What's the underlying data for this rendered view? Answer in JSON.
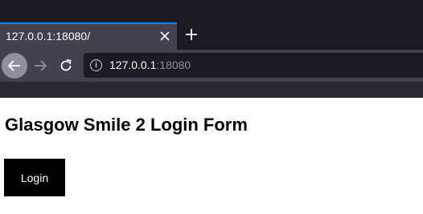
{
  "browser": {
    "tab_title": "127.0.0.1:18080/",
    "tab_close_icon": "close-icon",
    "new_tab_icon": "plus-icon",
    "back_icon": "arrow-left-icon",
    "forward_icon": "arrow-right-icon",
    "reload_icon": "reload-icon",
    "url_host": "127.0.0.1",
    "url_port": ":18080",
    "accent_color": "#0a84ff"
  },
  "page": {
    "title": "Glasgow Smile 2 Login Form",
    "login_button_label": "Login"
  }
}
